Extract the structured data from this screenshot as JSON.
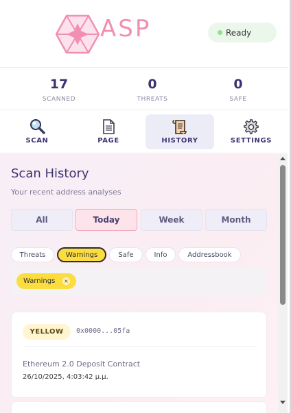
{
  "header": {
    "logo_text": "ASP",
    "status": "Ready"
  },
  "stats": [
    {
      "value": "17",
      "label": "SCANNED"
    },
    {
      "value": "0",
      "label": "THREATS"
    },
    {
      "value": "0",
      "label": "SAFE"
    }
  ],
  "nav": [
    {
      "label": "SCAN",
      "icon": "magnifier-icon"
    },
    {
      "label": "PAGE",
      "icon": "page-icon"
    },
    {
      "label": "HISTORY",
      "icon": "scroll-icon",
      "active": true
    },
    {
      "label": "SETTINGS",
      "icon": "gear-icon"
    }
  ],
  "history": {
    "title": "Scan History",
    "subtitle": "Your recent address analyses",
    "periods": [
      "All",
      "Today",
      "Week",
      "Month"
    ],
    "active_period": "Today",
    "filters": [
      "Threats",
      "Warnings",
      "Safe",
      "Info",
      "Addressbook"
    ],
    "active_filter": "Warnings",
    "active_chip": "Warnings",
    "chip_close": "×"
  },
  "entries": [
    {
      "level": "YELLOW",
      "address": "0x0000...05fa",
      "name": "Ethereum 2.0 Deposit Contract",
      "time": "26/10/2025, 4:03:42 μ.μ."
    }
  ],
  "colors": {
    "accent_pink": "#f28fb1",
    "warning_yellow": "#fcdd3f",
    "status_green": "#8ee38e",
    "text_dark": "#3d3370"
  }
}
